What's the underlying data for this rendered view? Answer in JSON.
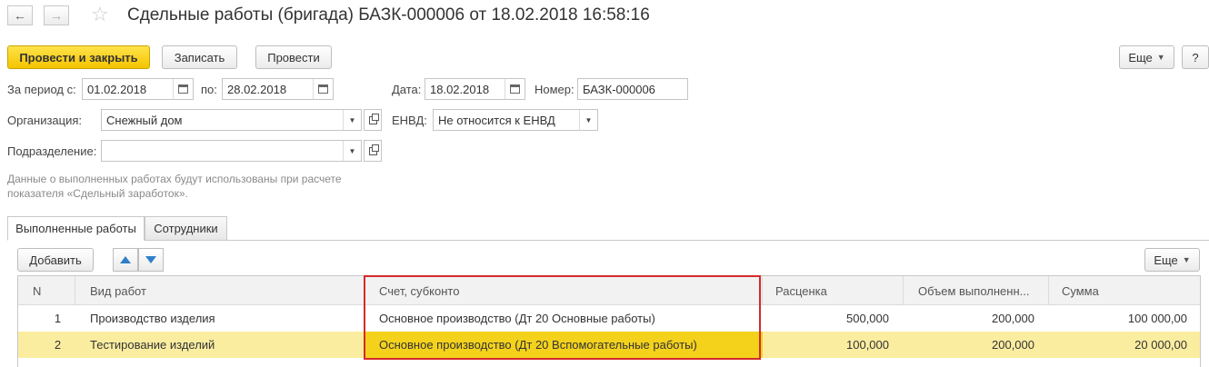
{
  "header": {
    "back_icon": "arrow-left-icon",
    "forward_icon": "arrow-right-icon",
    "favorite_icon": "star-icon",
    "title": "Сдельные работы (бригада) БАЗК-000006 от 18.02.2018 16:58:16"
  },
  "toolbar": {
    "post_close": "Провести и закрыть",
    "save": "Записать",
    "post": "Провести",
    "more": "Еще",
    "help": "?"
  },
  "form": {
    "period_from_label": "За период с:",
    "period_from": "01.02.2018",
    "period_to_label": "по:",
    "period_to": "28.02.2018",
    "date_label": "Дата:",
    "date": "18.02.2018",
    "number_label": "Номер:",
    "number": "БАЗК-000006",
    "org_label": "Организация:",
    "org": "Снежный дом",
    "envd_label": "ЕНВД:",
    "envd": "Не относится к ЕНВД",
    "dept_label": "Подразделение:",
    "dept": ""
  },
  "note": "Данные о выполненных работах будут использованы при расчете показателя «Сдельный заработок».",
  "tabs": [
    {
      "label": "Выполненные работы",
      "active": true
    },
    {
      "label": "Сотрудники",
      "active": false
    }
  ],
  "table_toolbar": {
    "add": "Добавить",
    "more": "Еще"
  },
  "table": {
    "columns": [
      "N",
      "Вид работ",
      "Счет, субконто",
      "Расценка",
      "Объем выполненн...",
      "Сумма"
    ],
    "rows": [
      {
        "n": "1",
        "work": "Производство изделия",
        "account": "Основное производство (Дт 20 Основные работы)",
        "rate": "500,000",
        "volume": "200,000",
        "sum": "100 000,00",
        "selected": false
      },
      {
        "n": "2",
        "work": "Тестирование изделий",
        "account": "Основное производство (Дт 20 Вспомогательные работы)",
        "rate": "100,000",
        "volume": "200,000",
        "sum": "20 000,00",
        "selected": true
      }
    ]
  },
  "colors": {
    "primary_button": "#f4c400",
    "selected_row": "#fbeda0",
    "current_cell": "#f4d21c",
    "highlight_border": "#d42a2a",
    "arrow": "#2f7fc8"
  }
}
